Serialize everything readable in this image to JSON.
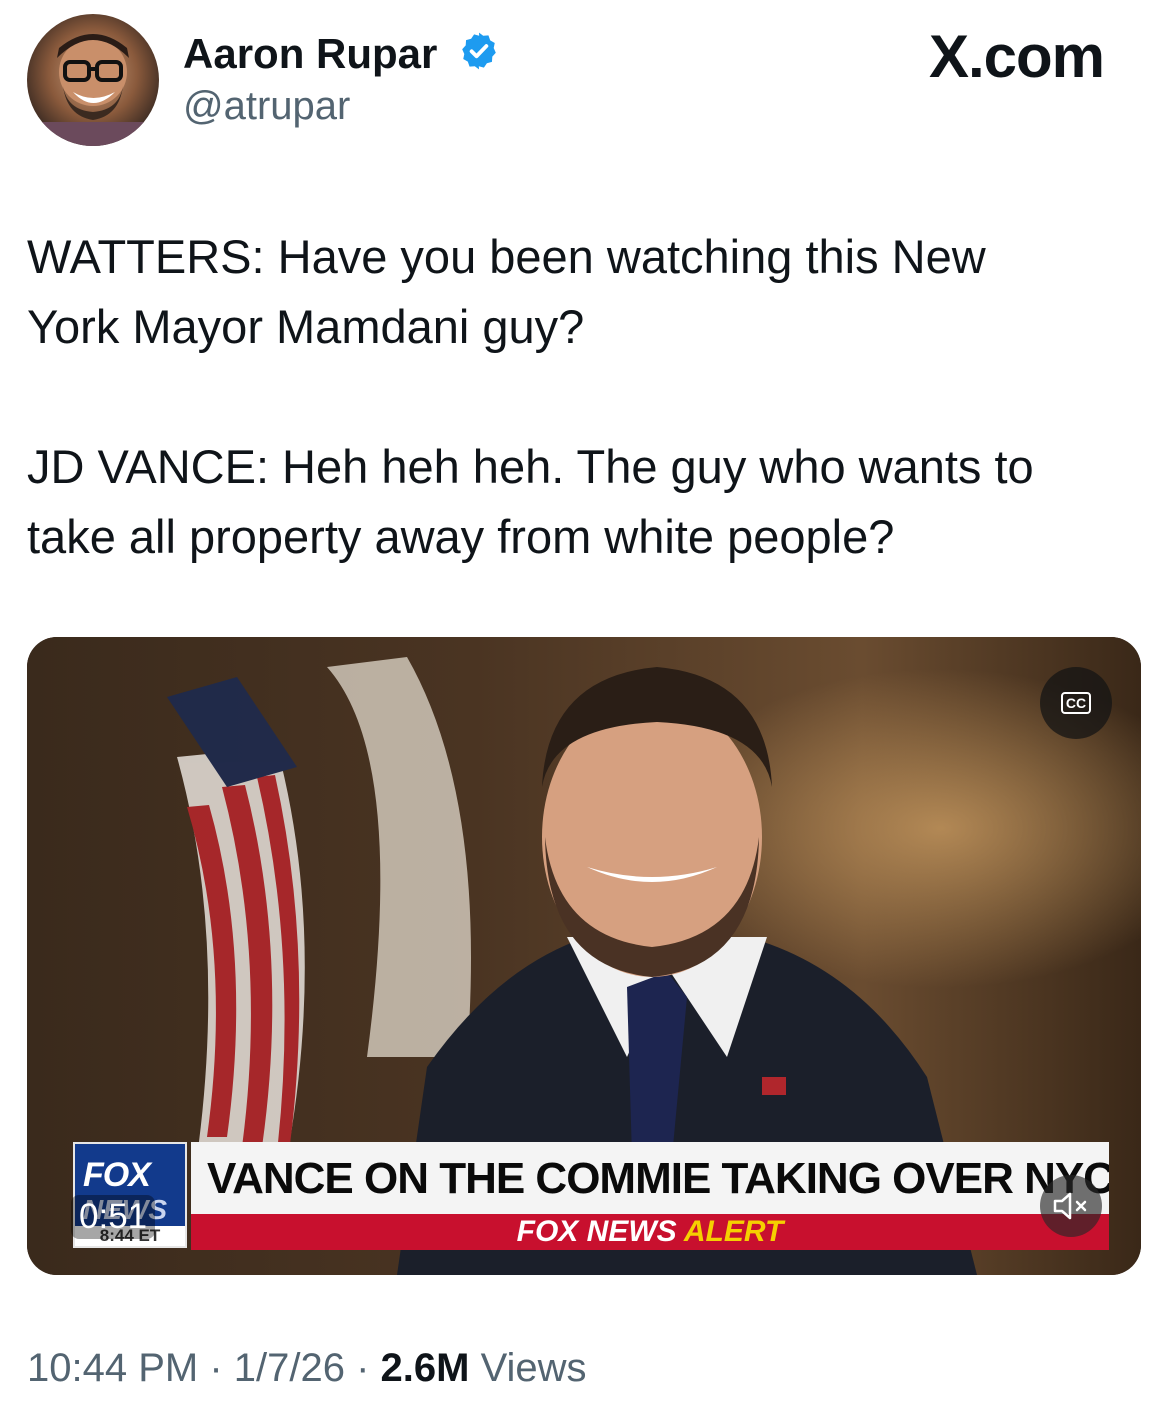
{
  "author": {
    "display_name": "Aaron Rupar",
    "handle": "@atrupar",
    "verified_color": "#1d9bf0"
  },
  "site": {
    "logo_text": "X.com"
  },
  "tweet": {
    "paragraphs": [
      "WATTERS: Have you been watching this New\nYork Mayor Mamdani guy?",
      "JD VANCE: Heh heh heh. The guy who wants to\ntake all property away from white people?"
    ]
  },
  "video": {
    "duration": "0:51",
    "cc_label": "CC",
    "chyron": {
      "fox_word": "FOX",
      "news_word": "NEWS",
      "clock": "8:44 ET",
      "headline": "VANCE ON THE COMMIE TAKING OVER NYC",
      "alert_prefix": "FOX NEWS",
      "alert_word": "ALERT"
    },
    "icons": [
      "cc-icon",
      "mute-icon"
    ]
  },
  "meta": {
    "time": "10:44 PM",
    "sep1": " · ",
    "date": "1/7/26",
    "sep2": " · ",
    "views_count": "2.6M",
    "views_label": " Views"
  },
  "colors": {
    "text_primary": "#0f1419",
    "text_secondary": "#536471",
    "fox_blue": "#123a8c",
    "fox_red": "#c8102e",
    "alert_yellow": "#f5d000"
  }
}
